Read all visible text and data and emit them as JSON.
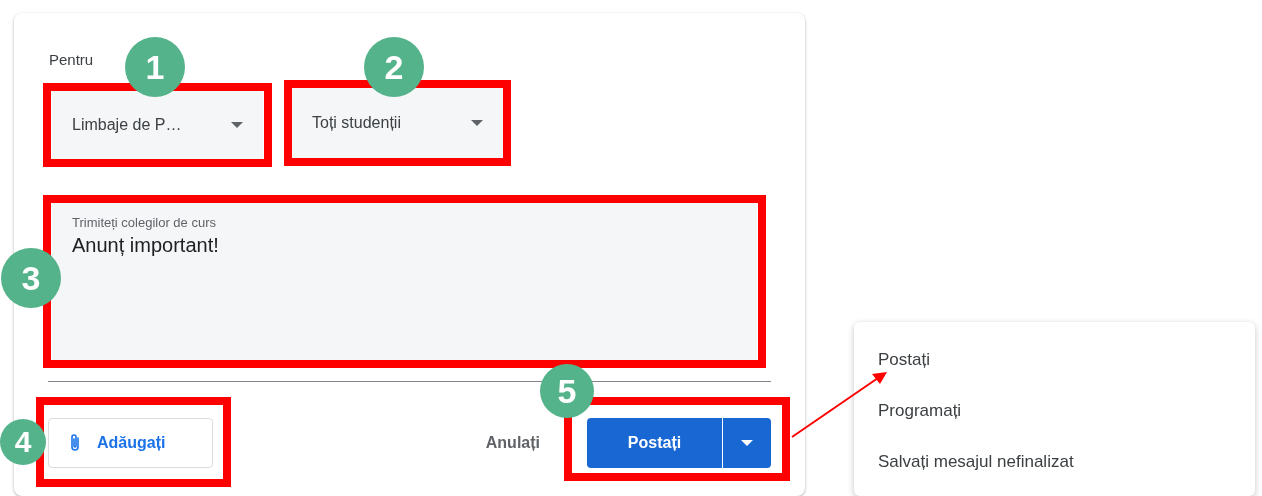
{
  "card": {
    "for_label": "Pentru",
    "class_dropdown": {
      "value": "Limbaje de P…"
    },
    "audience_dropdown": {
      "value": "Toți studenții"
    },
    "message": {
      "label": "Trimiteți colegilor de curs",
      "value": "Anunț important!"
    },
    "attach_button": "Adăugați",
    "cancel_button": "Anulați",
    "post_button": "Postați"
  },
  "post_menu": {
    "items": [
      {
        "label": "Postați"
      },
      {
        "label": "Programați"
      },
      {
        "label": "Salvați mesajul nefinalizat"
      }
    ]
  },
  "annotations": [
    {
      "label": "1"
    },
    {
      "label": "2"
    },
    {
      "label": "3"
    },
    {
      "label": "4"
    },
    {
      "label": "5"
    }
  ],
  "pointer_arrow": true
}
